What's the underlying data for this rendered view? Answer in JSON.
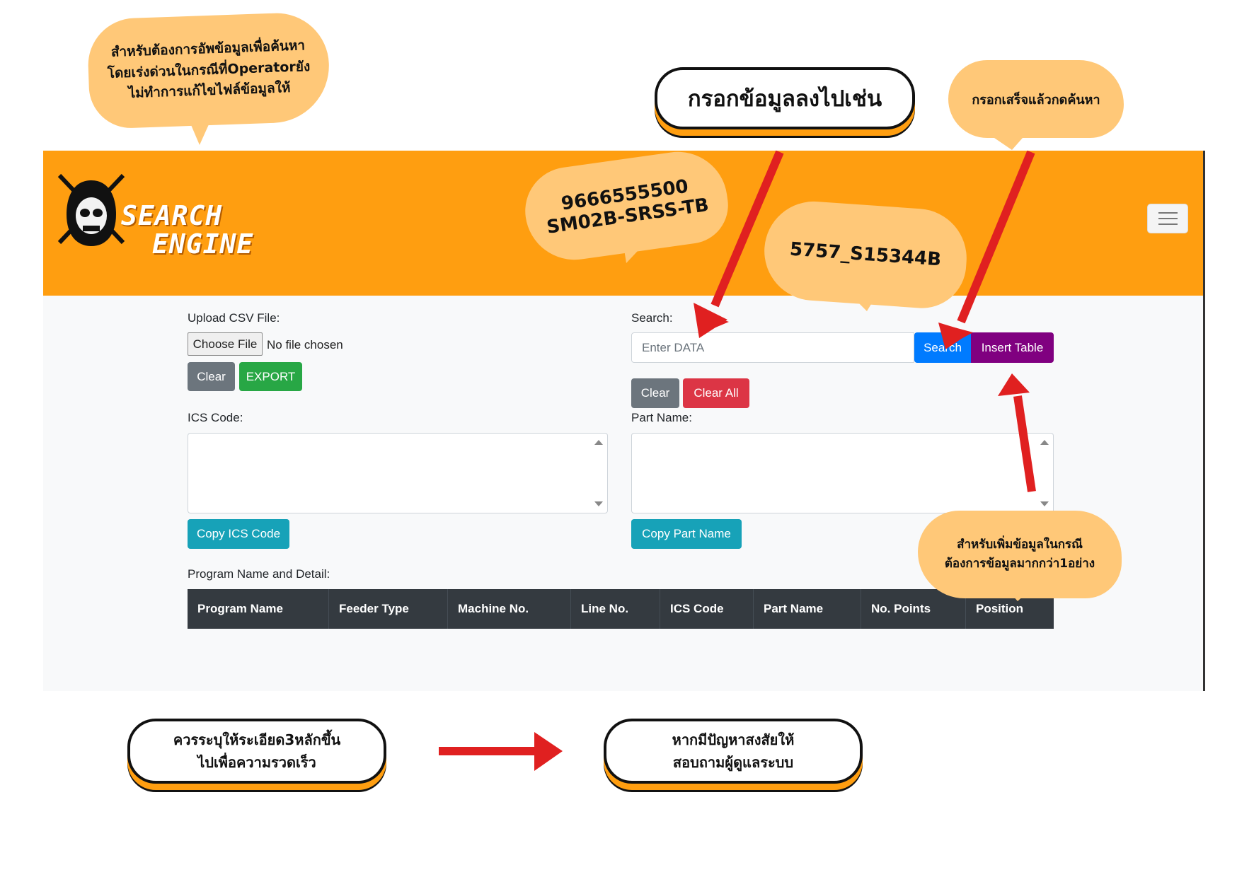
{
  "brand": {
    "line1": "SEARCH",
    "line2": "ENGINE"
  },
  "upload": {
    "label": "Upload CSV File:",
    "file_button": "Choose File",
    "file_status": "No file chosen",
    "clear": "Clear",
    "export": "EXPORT"
  },
  "search": {
    "label": "Search:",
    "placeholder": "Enter DATA",
    "search_button": "Search",
    "insert_button": "Insert Table",
    "clear": "Clear",
    "clear_all": "Clear All"
  },
  "ics": {
    "label": "ICS Code:",
    "copy_button": "Copy ICS Code"
  },
  "part": {
    "label": "Part Name:",
    "copy_button": "Copy Part Name"
  },
  "program": {
    "label": "Program Name and Detail:",
    "columns": [
      "Program Name",
      "Feeder Type",
      "Machine No.",
      "Line No.",
      "ICS Code",
      "Part Name",
      "No. Points",
      "Position"
    ]
  },
  "annotations": {
    "upload_note": "สำหรับต้องการอัพข้อมูลเพื่อค้นหาโดยเร่งด่วนในกรณีที่Operatorยังไม่ทำการแก้ไขไฟล์ข้อมูลให้",
    "enter_data": "กรอกข้อมูลลงไปเช่น",
    "press_search": "กรอกเสร็จแล้วกดค้นหา",
    "example1_line1": "9666555500",
    "example1_line2": "SM02B-SRSS-TB",
    "example2": "5757_S15344B",
    "insert_note": "สำหรับเพิ่มข้อมูลในกรณีต้องการข้อมูลมากกว่า1อย่าง",
    "detail_note": "ควรระบุให้ระเอียด3หลักขึ้นไปเพื่อความรวดเร็ว",
    "contact_note": "หากมีปัญหาสงสัยให้สอบถามผู้ดูแลระบบ"
  },
  "colors": {
    "navbar": "#ff9e10",
    "bubble": "#ffc878",
    "arrow": "#e02020",
    "insert_button": "#800080"
  }
}
